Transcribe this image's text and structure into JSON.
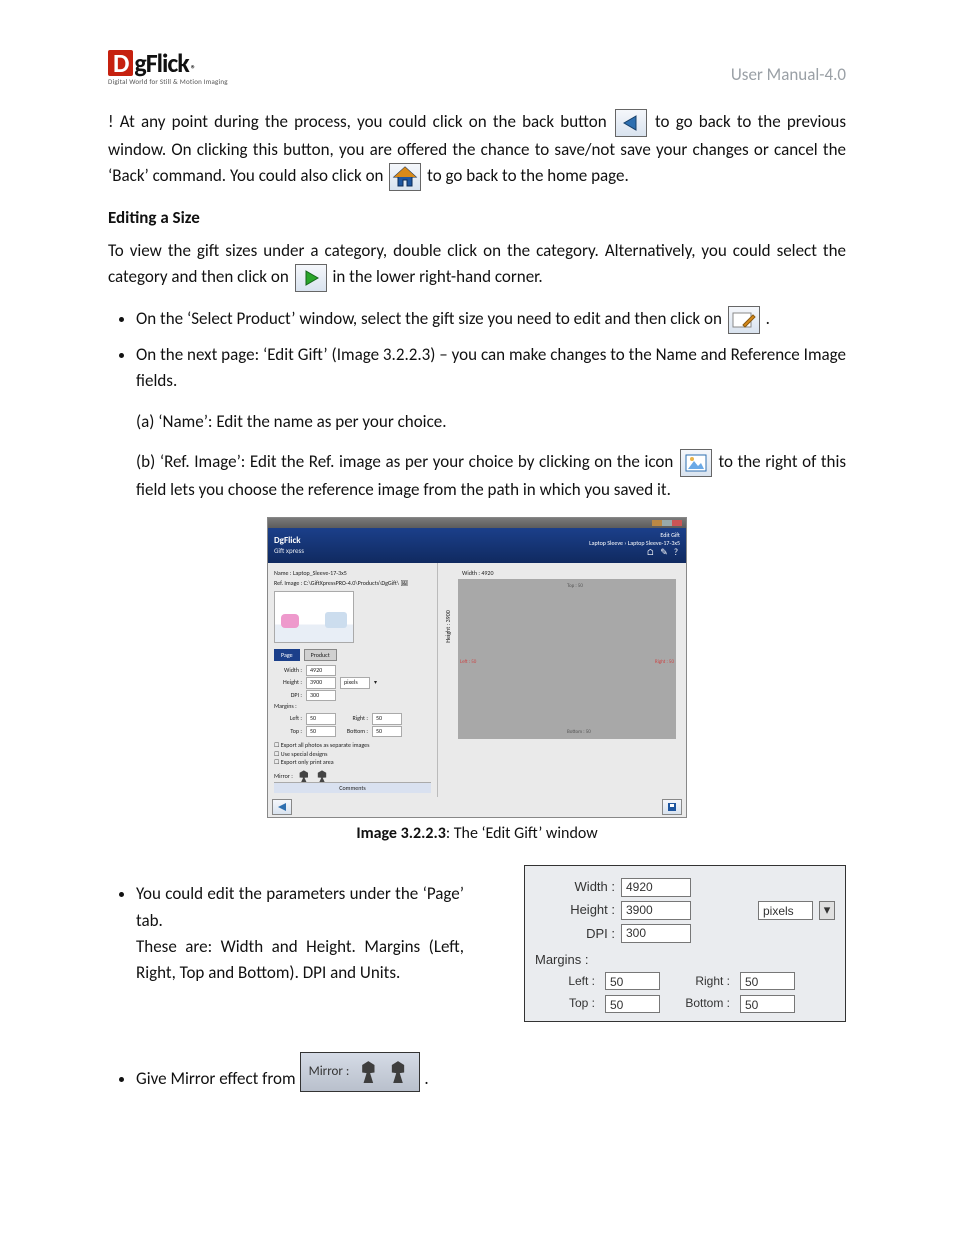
{
  "header": {
    "logo": {
      "d": "D",
      "rest": "gFlick",
      "reg": "®",
      "tagline": "Digital World for Still & Motion Imaging"
    },
    "right": "User Manual-4.0"
  },
  "intro": {
    "p1_pre": "! At any point during the process, you could click on the back button ",
    "p1_post": " to go back to the previous window. On clicking this button, you are offered the chance to save/not save your changes or cancel the ‘Back’ command. You could also click on ",
    "p1_end": " to go back to the home page."
  },
  "section": {
    "title": "Editing a Size"
  },
  "edit": {
    "p2_pre": "To view the gift sizes under a category, double click on the category. Alternatively, you could select the category and then click on ",
    "p2_post": " in the lower right-hand corner.",
    "b1_pre": "On the ‘Select Product’ window, select the gift size you need to edit and then click on ",
    "b1_post": ".",
    "b2": "On the next page: ‘Edit Gift’ (Image 3.2.2.3) – you can make changes to the Name and Reference Image fields.",
    "a": "(a) ‘Name’: Edit the name as per your choice.",
    "b_pre": "(b) ‘Ref. Image’: Edit the Ref. image as per your choice by clicking on the icon ",
    "b_post": " to the right of this field lets you choose the reference image from the path in which you saved it."
  },
  "egw": {
    "brand": "DgFlick",
    "sub": "Gift xpress",
    "right_top": "Edit Gift",
    "breadcrumb": "Laptop Sleeve › Laptop Sleeve-17-3x5",
    "name_lbl": "Name :",
    "name_val": "Laptop_Sleeve-17-3x5",
    "ref_lbl": "Ref. Image :",
    "ref_val": "C:\\GiftXpressPRO-4.0\\Products\\DgGift\\",
    "tab_page": "Page",
    "tab_product": "Product",
    "w_lbl": "Width :",
    "w_val": "4920",
    "h_lbl": "Height :",
    "h_val": "3900",
    "unit": "pixels",
    "dpi_lbl": "DPI :",
    "dpi_val": "300",
    "margins_lbl": "Margins :",
    "left_lbl": "Left :",
    "left_val": "50",
    "right_lbl": "Right :",
    "right_val": "50",
    "top_lbl": "Top :",
    "top_val": "50",
    "bot_lbl": "Bottom :",
    "bot_val": "50",
    "chk1": "Export all photos as separate images",
    "chk2": "Use special designs",
    "chk3": "Export only print area",
    "mirror_lbl": "Mirror :",
    "comments": "Comments",
    "axis_w": "Width : 4920",
    "axis_h": "Height : 3900",
    "g_top": "Top : 50",
    "g_bot": "Bottom : 50",
    "g_left": "Left : 50",
    "g_right": "Right : 50"
  },
  "caption": {
    "bold": "Image 3.2.2.3",
    "rest": ": The ‘Edit Gift’ window"
  },
  "page_tab": {
    "b1": "You could edit the parameters under the ‘Page’ tab.",
    "b1b": "These are: Width and Height. Margins (Left, Right, Top and Bottom). DPI and Units."
  },
  "params": {
    "w_lbl": "Width :",
    "w_val": "4920",
    "h_lbl": "Height :",
    "h_val": "3900",
    "dpi_lbl": "DPI :",
    "dpi_val": "300",
    "unit": "pixels",
    "margins": "Margins :",
    "left_lbl": "Left :",
    "left_val": "50",
    "right_lbl": "Right :",
    "right_val": "50",
    "top_lbl": "Top :",
    "top_val": "50",
    "bot_lbl": "Bottom :",
    "bot_val": "50"
  },
  "mirror": {
    "b_pre": "Give Mirror effect from ",
    "label": "Mirror :",
    "b_post": " ."
  }
}
